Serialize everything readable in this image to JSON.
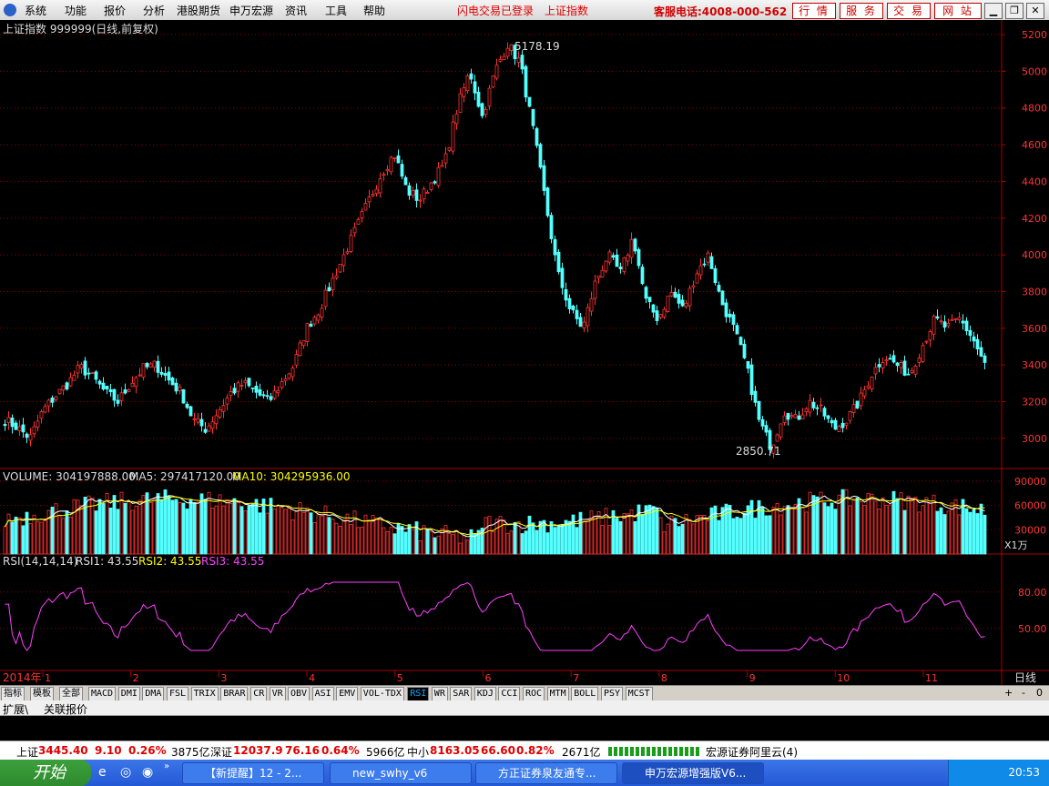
{
  "menubar": {
    "items": [
      "系统",
      "功能",
      "报价",
      "分析",
      "港股期货",
      "申万宏源",
      "资讯",
      "工具",
      "帮助"
    ],
    "notice_login": "闪电交易已登录",
    "notice_index": "上证指数",
    "hotline": "客服电话:4008-000-562",
    "buttons": [
      "行 情",
      "服 务",
      "交 易",
      "网 站"
    ]
  },
  "chart_header": {
    "title": "上证指数 999999(日线,前复权)",
    "max_marker": "5178.19",
    "min_marker": "2850.71"
  },
  "volume_header": {
    "volume": "VOLUME: 304197888.00",
    "ma5": "MA5: 297417120.00",
    "ma10": "MA10: 304295936.00",
    "unit": "X1万"
  },
  "rsi_header": {
    "params": "RSI(14,14,14)",
    "rsi1": "RSI1: 43.55",
    "rsi2": "RSI2: 43.55",
    "rsi3": "RSI3: 43.55"
  },
  "axis": {
    "year_label": "2014年",
    "months": [
      "1",
      "2",
      "3",
      "4",
      "5",
      "6",
      "7",
      "8",
      "9",
      "10",
      "11"
    ],
    "period": "日线"
  },
  "indicator_tabs": [
    "指标",
    "模板",
    "全部",
    "MACD",
    "DMI",
    "DMA",
    "FSL",
    "TRIX",
    "BRAR",
    "CR",
    "VR",
    "OBV",
    "ASI",
    "EMV",
    "VOL-TDX",
    "RSI",
    "WR",
    "SAR",
    "KDJ",
    "CCI",
    "ROC",
    "MTM",
    "BOLL",
    "PSY",
    "MCST"
  ],
  "active_tab": "RSI",
  "strip_controls": [
    "+",
    "-",
    "0"
  ],
  "sub_tabs": [
    "扩展\\",
    "关联报价"
  ],
  "ticker": {
    "sh_label": "上证",
    "sh_value": "3445.40",
    "sh_change": "9.10",
    "sh_pct": "0.26%",
    "sh_amount": "3875亿",
    "sz_label": "深证",
    "sz_value": "12037.9",
    "sz_change": "76.16",
    "sz_pct": "0.64%",
    "sz_amount": "5966亿",
    "zx_label": "中小",
    "zx_value": "8163.05",
    "zx_change": "66.60",
    "zx_pct": "0.82%",
    "zx_amount": "2671亿",
    "broker": "宏源证券阿里云(4)"
  },
  "taskbar": {
    "start": "开始",
    "tasks": [
      "【新提醒】12 - 2...",
      "new_swhy_v6",
      "方正证券泉友通专...",
      "申万宏源增强版V6..."
    ],
    "clock": "20:53"
  },
  "colors": {
    "up": "#ff3333",
    "down": "#54ffff",
    "rsi": "#ff40ff",
    "ma5": "#ffffff",
    "ma10": "#ffff00",
    "grid": "#8b0000"
  },
  "chart_data": [
    {
      "type": "candlestick",
      "title": "上证指数 999999(日线,前复权)",
      "ylim": [
        2900,
        5250
      ],
      "yticks": [
        3000,
        3200,
        3400,
        3600,
        3800,
        4000,
        4200,
        4400,
        4600,
        4800,
        5000,
        5200
      ],
      "x_months": [
        "1",
        "2",
        "3",
        "4",
        "5",
        "6",
        "7",
        "8",
        "9",
        "10",
        "11"
      ],
      "annotations": [
        {
          "label": "5178.19",
          "value": 5178.19
        },
        {
          "label": "2850.71",
          "value": 2850.71
        }
      ],
      "close_path": [
        3100,
        3060,
        3000,
        3150,
        3230,
        3300,
        3390,
        3330,
        3250,
        3200,
        3300,
        3380,
        3400,
        3320,
        3250,
        3100,
        3050,
        3150,
        3250,
        3300,
        3250,
        3200,
        3300,
        3400,
        3600,
        3700,
        3850,
        4000,
        4150,
        4300,
        4450,
        4550,
        4350,
        4300,
        4400,
        4500,
        4800,
        5000,
        4750,
        5000,
        5150,
        5050,
        4700,
        4300,
        3900,
        3700,
        3600,
        3850,
        4000,
        3900,
        4100,
        3750,
        3650,
        3800,
        3700,
        3900,
        4000,
        3750,
        3600,
        3400,
        3100,
        2950,
        3150,
        3100,
        3200,
        3150,
        3050,
        3100,
        3200,
        3350,
        3450,
        3400,
        3350,
        3500,
        3650,
        3600,
        3650,
        3550,
        3400
      ],
      "volume": {
        "ylim": [
          0,
          100000
        ],
        "yticks": [
          30000,
          60000,
          90000
        ],
        "unit": "X1万"
      },
      "rsi": {
        "ylim": [
          20,
          100
        ],
        "yticks": [
          50.0,
          80.0
        ],
        "last": 43.55
      }
    }
  ]
}
